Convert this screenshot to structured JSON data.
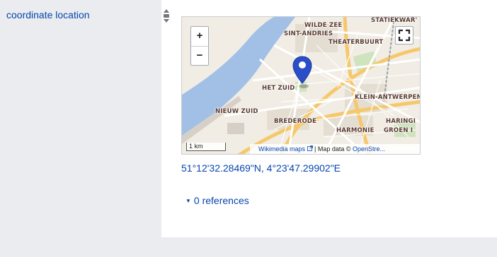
{
  "property": {
    "label": "coordinate location"
  },
  "map": {
    "districts": {
      "wilde_zee": "WILDE ZEE",
      "statiekwart": "STATIEKWAR'",
      "sint_andries": "SINT-ANDRIES",
      "theaterbuurt": "THEATERBUURT",
      "het_zuid": "HET ZUID",
      "klein_antwerpen": "KLEIN-ANTWERPEN",
      "nieuw_zuid": "NIEUW ZUID",
      "brederode": "BREDERODE",
      "haringi": "HARINGI",
      "harmonie": "HARMONIE",
      "groen": "GROEN I"
    },
    "zoom_in_label": "+",
    "zoom_out_label": "−",
    "scale_label": "1 km",
    "attribution": {
      "wikimedia_maps": "Wikimedia maps",
      "separator": " | Map data © ",
      "openstreetmap": "OpenStre..."
    },
    "icons": {
      "marker": "map-marker-icon",
      "fullscreen": "fullscreen-icon",
      "external_link": "external-link-icon"
    },
    "colors": {
      "water": "#a2c0e6",
      "marker": "#2a4ec8",
      "land": "#f1ede4"
    }
  },
  "statement": {
    "coordinates": "51°12'32.28469\"N, 4°23'47.29902\"E",
    "references_toggle": "0 references"
  }
}
